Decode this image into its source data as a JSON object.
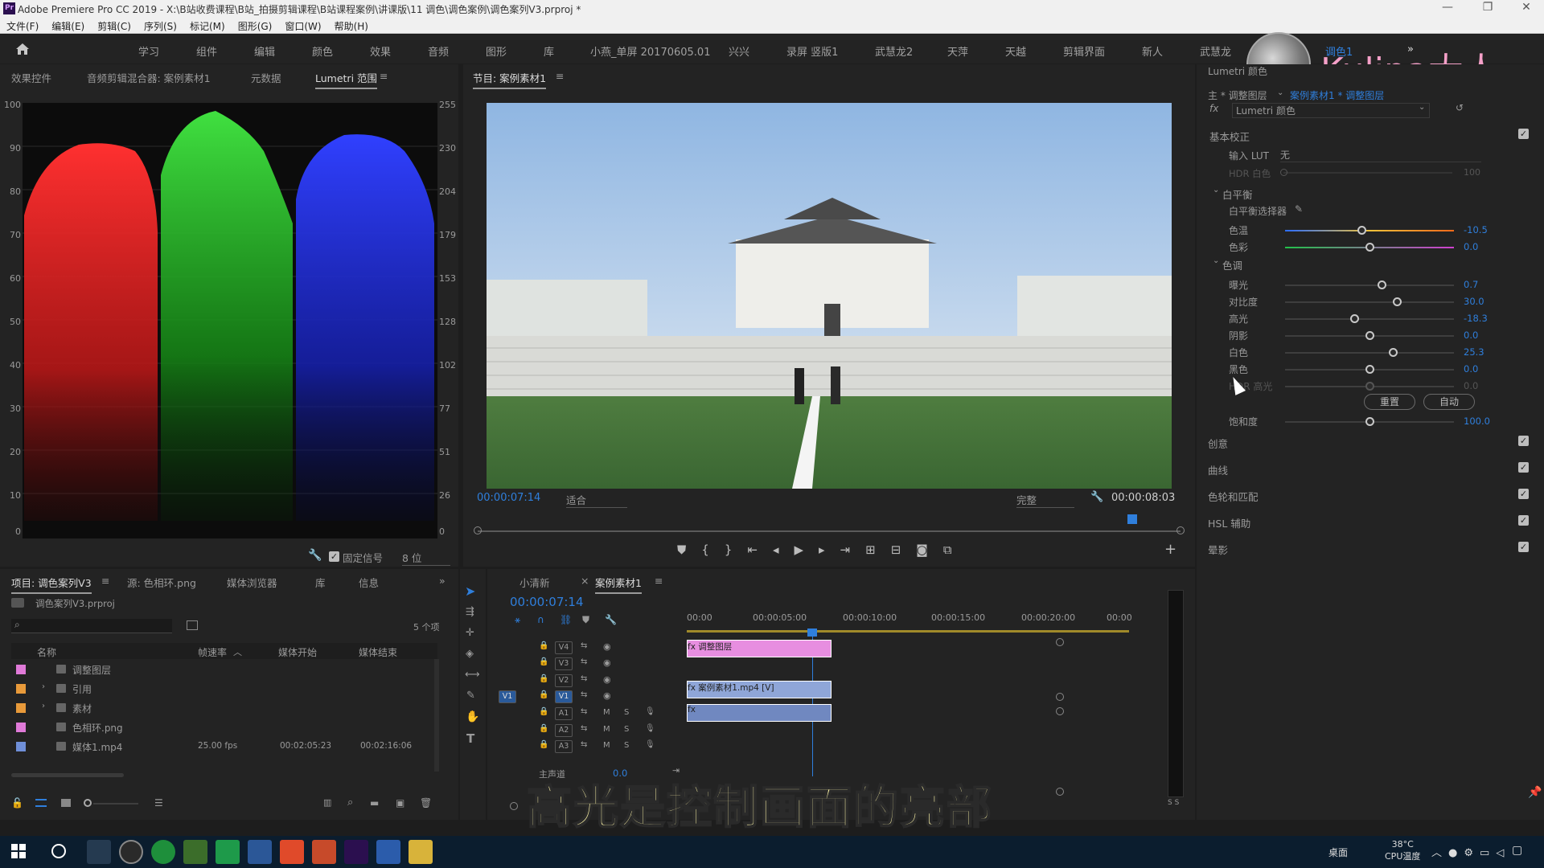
{
  "window": {
    "title": "Adobe Premiere Pro CC 2019 - X:\\B站收费课程\\B站_拍摄剪辑课程\\B站课程案例\\讲课版\\11 调色\\调色案例\\调色案列V3.prproj *",
    "logo_text": "Pr"
  },
  "menu": [
    "文件(F)",
    "编辑(E)",
    "剪辑(C)",
    "序列(S)",
    "标记(M)",
    "图形(G)",
    "窗口(W)",
    "帮助(H)"
  ],
  "workspaces": [
    "学习",
    "组件",
    "编辑",
    "颜色",
    "效果",
    "音频",
    "图形",
    "库",
    "小燕_单屏 20170605.01",
    "兴兴",
    "录屏 竖版1",
    "武慧龙2",
    "天萍",
    "天越",
    "剪辑界面",
    "新人",
    "武慧龙",
    "调色1"
  ],
  "workspaces_more": "»",
  "watermark": "Kulipa大人",
  "scopes": {
    "tabs": [
      "效果控件",
      "音频剪辑混合器: 案例素材1",
      "元数据",
      "Lumetri 范围"
    ],
    "menu_icon": "≡",
    "left_ticks": [
      "100",
      "90",
      "80",
      "70",
      "60",
      "50",
      "40",
      "30",
      "20",
      "10",
      "0"
    ],
    "right_ticks": [
      "255",
      "230",
      "204",
      "179",
      "153",
      "128",
      "102",
      "77",
      "51",
      "26",
      "0"
    ],
    "clamp_label": "固定信号",
    "bit_depth": "8 位",
    "colors": {
      "red": "#ff2a2a",
      "green": "#2dd12d",
      "blue": "#2a3cff"
    }
  },
  "program": {
    "tab": "节目: 案例素材1",
    "timecode": "00:00:07:14",
    "fit": "适合",
    "quality": "完整",
    "duration": "00:00:08:03"
  },
  "project": {
    "tabs": [
      "项目: 调色案列V3",
      "源: 色相环.png",
      "媒体浏览器",
      "库",
      "信息",
      "»"
    ],
    "file": "调色案列V3.prproj",
    "item_count": "5 个项",
    "columns": [
      "名称",
      "帧速率",
      "媒体开始",
      "媒体结束"
    ],
    "rows": [
      {
        "color": "#e07ad8",
        "name": "调整图层",
        "fps": "",
        "start": "",
        "end": ""
      },
      {
        "color": "#e89a3a",
        "name": "引用",
        "fps": "",
        "start": "",
        "end": ""
      },
      {
        "color": "#e89a3a",
        "name": "素材",
        "fps": "",
        "start": "",
        "end": ""
      },
      {
        "color": "#e07ad8",
        "name": "色相环.png",
        "fps": "",
        "start": "",
        "end": ""
      },
      {
        "color": "#6f8fd8",
        "name": "媒体1.mp4",
        "fps": "25.00 fps",
        "start": "00:02:05:23",
        "end": "00:02:16:06"
      }
    ]
  },
  "timeline": {
    "tabs": [
      "小清新",
      "案例素材1"
    ],
    "timecode": "00:00:07:14",
    "ruler": [
      "00:00",
      "00:00:05:00",
      "00:00:10:00",
      "00:00:15:00",
      "00:00:20:00",
      "00:00"
    ],
    "tracks": [
      "V4",
      "V3",
      "V2",
      "V1",
      "A1",
      "A2",
      "A3"
    ],
    "master": "主声道",
    "master_value": "0.0",
    "clips": [
      {
        "name": "调整图层",
        "color": "#e78ee0"
      },
      {
        "name": "案例素材1.mp4 [V]",
        "color": "#8fa6d8"
      },
      {
        "name": "",
        "color": "#7088c0"
      }
    ],
    "meter_label": "S S"
  },
  "lumetri": {
    "header": "Lumetri 颜色",
    "source_master": "主 * 调整图层",
    "source_link": "案例素材1 * 调整图层",
    "effect": "Lumetri 颜色",
    "basic": "基本校正",
    "input_lut_label": "输入 LUT",
    "input_lut_value": "无",
    "hdr_white_label": "HDR 白色",
    "hdr_white_value": "100",
    "wb_section": "白平衡",
    "wb_selector": "白平衡选择器",
    "tone_section": "色调",
    "sliders": [
      {
        "label": "色温",
        "value": "-10.5",
        "pos": 0.45
      },
      {
        "label": "色彩",
        "value": "0.0",
        "pos": 0.5
      },
      {
        "label": "曝光",
        "value": "0.7",
        "pos": 0.57
      },
      {
        "label": "对比度",
        "value": "30.0",
        "pos": 0.66
      },
      {
        "label": "高光",
        "value": "-18.3",
        "pos": 0.41
      },
      {
        "label": "阴影",
        "value": "0.0",
        "pos": 0.5
      },
      {
        "label": "白色",
        "value": "25.3",
        "pos": 0.64
      },
      {
        "label": "黑色",
        "value": "0.0",
        "pos": 0.5
      },
      {
        "label": "HDR 高光",
        "value": "0.0",
        "pos": 0.5
      },
      {
        "label": "饱和度",
        "value": "100.0",
        "pos": 0.5
      }
    ],
    "reset_button": "重置",
    "auto_button": "自动",
    "sections": [
      "创意",
      "曲线",
      "色轮和匹配",
      "HSL 辅助",
      "晕影"
    ]
  },
  "subtitle": "高光是控制画面的亮部",
  "taskbar": {
    "desktop": "桌面",
    "temp": "38°C",
    "temp_label": "CPU温度"
  }
}
